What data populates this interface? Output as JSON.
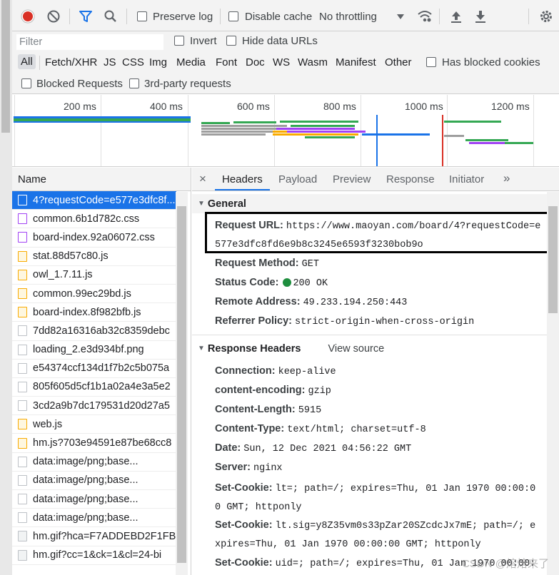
{
  "toolbar": {
    "preserve_log": "Preserve log",
    "disable_cache": "Disable cache",
    "throttling": "No throttling"
  },
  "filter": {
    "placeholder": "Filter",
    "invert": "Invert",
    "hide_data_urls": "Hide data URLs"
  },
  "types": [
    "All",
    "Fetch/XHR",
    "JS",
    "CSS",
    "Img",
    "Media",
    "Font",
    "Doc",
    "WS",
    "Wasm",
    "Manifest",
    "Other"
  ],
  "has_blocked_cookies": "Has blocked cookies",
  "blocked_requests": "Blocked Requests",
  "third_party": "3rd-party requests",
  "overview": {
    "ticks": [
      "200 ms",
      "400 ms",
      "600 ms",
      "800 ms",
      "1000 ms",
      "1200 ms"
    ]
  },
  "name_column": {
    "header": "Name",
    "requests": [
      {
        "name": "4?requestCode=e577e3dfc8f...",
        "type": "doc"
      },
      {
        "name": "common.6b1d782c.css",
        "type": "css"
      },
      {
        "name": "board-index.92a06072.css",
        "type": "css"
      },
      {
        "name": "stat.88d57c80.js",
        "type": "js"
      },
      {
        "name": "owl_1.7.11.js",
        "type": "js"
      },
      {
        "name": "common.99ec29bd.js",
        "type": "js"
      },
      {
        "name": "board-index.8f982bfb.js",
        "type": "js"
      },
      {
        "name": "7dd82a16316ab32c8359debc",
        "type": "img"
      },
      {
        "name": "loading_2.e3d934bf.png",
        "type": "img"
      },
      {
        "name": "e54374ccf134d1f7b2c5b075a",
        "type": "img"
      },
      {
        "name": "805f605d5cf1b1a02a4e3a5e2",
        "type": "img"
      },
      {
        "name": "3cd2a9b7dc179531d20d27a5",
        "type": "img"
      },
      {
        "name": "web.js",
        "type": "js"
      },
      {
        "name": "hm.js?703e94591e87be68cc8",
        "type": "js"
      },
      {
        "name": "data:image/png;base...",
        "type": "img"
      },
      {
        "name": "data:image/png;base...",
        "type": "img"
      },
      {
        "name": "data:image/png;base...",
        "type": "img"
      },
      {
        "name": "data:image/png;base...",
        "type": "img"
      },
      {
        "name": "hm.gif?hca=F7ADDEBD2F1FB",
        "type": "other"
      },
      {
        "name": "hm.gif?cc=1&ck=1&cl=24-bi",
        "type": "other"
      }
    ]
  },
  "detail": {
    "tabs": [
      "Headers",
      "Payload",
      "Preview",
      "Response",
      "Initiator"
    ],
    "more": "»",
    "close": "×",
    "general": {
      "title": "General",
      "request_url_key": "Request URL:",
      "request_url_line1": "https://www.maoyan.com/board/4?requestCode=e",
      "request_url_line2": "577e3dfc8fd6e9b8c3245e6593f3230bob9o",
      "method_key": "Request Method:",
      "method_val": "GET",
      "status_key": "Status Code:",
      "status_val": "200 OK",
      "remote_key": "Remote Address:",
      "remote_val": "49.233.194.250:443",
      "referrer_key": "Referrer Policy:",
      "referrer_val": "strict-origin-when-cross-origin"
    },
    "response_headers": {
      "title": "Response Headers",
      "view_source": "View source",
      "items": [
        {
          "key": "Connection:",
          "val": "keep-alive"
        },
        {
          "key": "content-encoding:",
          "val": "gzip"
        },
        {
          "key": "Content-Length:",
          "val": "5915"
        },
        {
          "key": "Content-Type:",
          "val": "text/html; charset=utf-8"
        },
        {
          "key": "Date:",
          "val": "Sun, 12 Dec 2021 04:56:22 GMT"
        },
        {
          "key": "Server:",
          "val": "nginx"
        }
      ],
      "cookie1_key": "Set-Cookie:",
      "cookie1_l1": "lt=; path=/; expires=Thu, 01 Jan 1970 00:00:0",
      "cookie1_l2": "0 GMT; httponly",
      "cookie2_key": "Set-Cookie:",
      "cookie2_l1": "lt.sig=y8Z35vm0s33pZar20SZcdcJx7mE; path=/; e",
      "cookie2_l2": "xpires=Thu, 01 Jan 1970 00:00:00 GMT; httponly",
      "cookie3_key": "Set-Cookie:",
      "cookie3_l1": "uid=; path=/; expires=Thu, 01 Jan 1970 00:00:"
    }
  },
  "watermark": "CSDN @熔熔来了"
}
